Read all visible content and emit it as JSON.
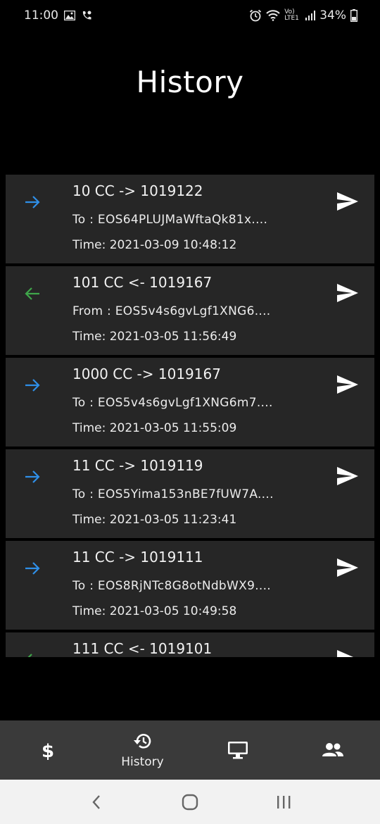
{
  "status_bar": {
    "time": "11:00",
    "battery": "34%",
    "network_label": "Vo) LTE1"
  },
  "page_title": "History",
  "transactions": [
    {
      "direction": "out",
      "title": "10 CC -> 1019122",
      "address": "To : EOS64PLUJMaWftaQk81x....",
      "time": "Time: 2021-03-09 10:48:12"
    },
    {
      "direction": "in",
      "title": "101 CC <- 1019167",
      "address": "From : EOS5v4s6gvLgf1XNG6....",
      "time": "Time: 2021-03-05 11:56:49"
    },
    {
      "direction": "out",
      "title": "1000 CC -> 1019167",
      "address": "To : EOS5v4s6gvLgf1XNG6m7....",
      "time": "Time: 2021-03-05 11:55:09"
    },
    {
      "direction": "out",
      "title": "11 CC -> 1019119",
      "address": "To : EOS5Yima153nBE7fUW7A....",
      "time": "Time: 2021-03-05 11:23:41"
    },
    {
      "direction": "out",
      "title": "11 CC -> 1019111",
      "address": "To : EOS8RjNTc8G8otNdbWX9....",
      "time": "Time: 2021-03-05 10:49:58"
    },
    {
      "direction": "in",
      "title": "111 CC <- 1019101",
      "address": "",
      "time": ""
    }
  ],
  "colors": {
    "outgoing_arrow": "#2f8fe8",
    "incoming_arrow": "#3fa64a",
    "card_bg": "#262626",
    "nav_bg": "#3a3a3a"
  },
  "bottom_nav": {
    "items": [
      {
        "icon": "dollar-icon",
        "label": ""
      },
      {
        "icon": "history-icon",
        "label": "History"
      },
      {
        "icon": "monitor-icon",
        "label": ""
      },
      {
        "icon": "people-icon",
        "label": ""
      }
    ]
  },
  "system_nav": {
    "icons": [
      "back-icon",
      "home-icon",
      "recents-icon"
    ]
  }
}
